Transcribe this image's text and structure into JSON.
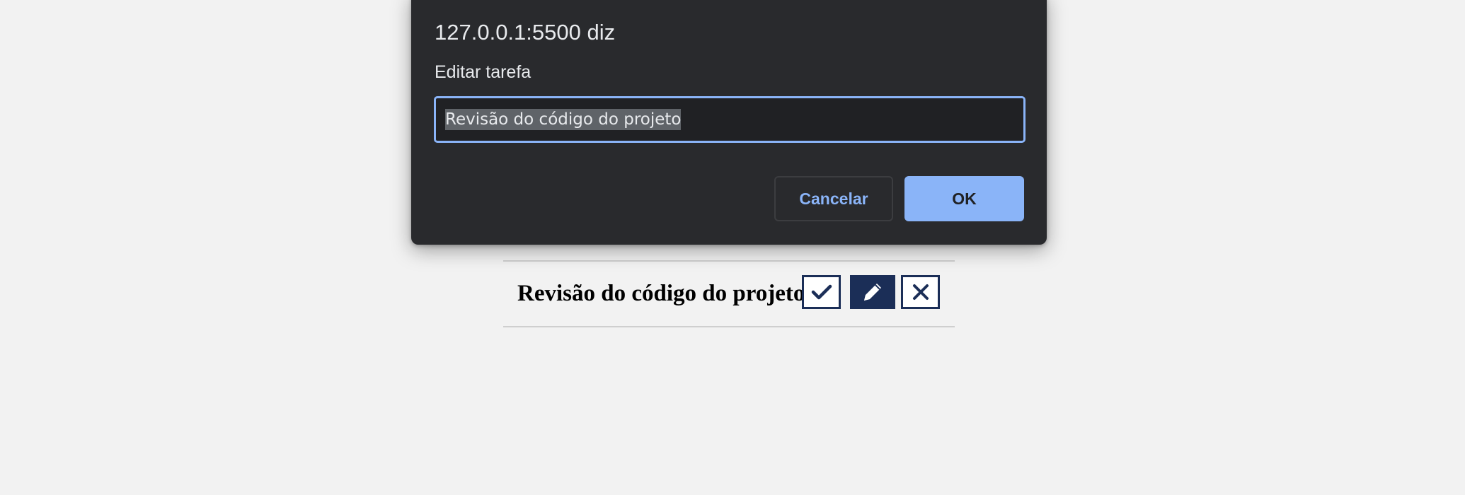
{
  "dialog": {
    "title": "127.0.0.1:5500 diz",
    "message": "Editar tarefa",
    "input_value": "Revisão do código do projeto",
    "cancel_label": "Cancelar",
    "ok_label": "OK"
  },
  "todo": {
    "items": [
      {
        "text": "Revisão do código do projeto",
        "actions": [
          "check-icon",
          "pencil-icon",
          "close-icon"
        ]
      }
    ]
  },
  "colors": {
    "page_background": "#f2f2f2",
    "dialog_background": "#292a2d",
    "dialog_input_border": "#8ab4f8",
    "ok_button": "#8ab4f8",
    "icon_button_border": "#1b2e57"
  }
}
